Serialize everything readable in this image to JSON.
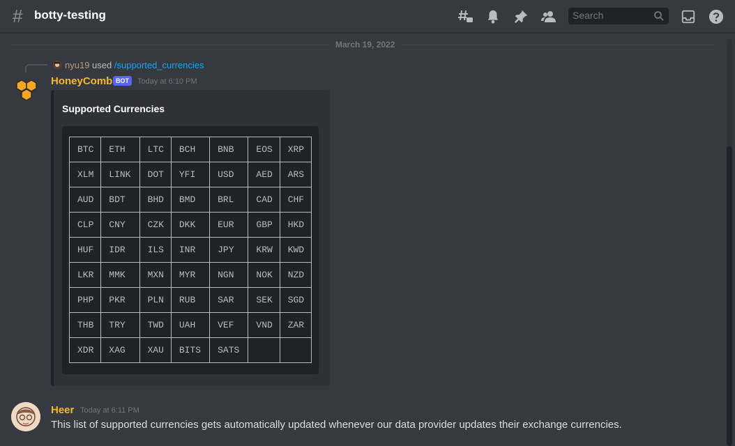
{
  "channel": {
    "hash": "#",
    "name": "botty-testing"
  },
  "toolbar": {
    "icons": [
      "threads-icon",
      "bell-icon",
      "pin-icon",
      "members-icon",
      "inbox-icon",
      "help-icon"
    ],
    "search_placeholder": "Search"
  },
  "divider": {
    "date": "March 19, 2022"
  },
  "reply": {
    "user": "nyu19",
    "used": "used",
    "command": "/supported_currencies"
  },
  "bot_message": {
    "author": "HoneyComb",
    "badge": "BOT",
    "timestamp": "Today at 6:10 PM",
    "author_color": "#f8b82d",
    "embed": {
      "title": "Supported Currencies",
      "rows": [
        [
          "BTC",
          "ETH",
          "LTC",
          "BCH",
          "BNB",
          "EOS",
          "XRP"
        ],
        [
          "XLM",
          "LINK",
          "DOT",
          "YFI",
          "USD",
          "AED",
          "ARS"
        ],
        [
          "AUD",
          "BDT",
          "BHD",
          "BMD",
          "BRL",
          "CAD",
          "CHF"
        ],
        [
          "CLP",
          "CNY",
          "CZK",
          "DKK",
          "EUR",
          "GBP",
          "HKD"
        ],
        [
          "HUF",
          "IDR",
          "ILS",
          "INR",
          "JPY",
          "KRW",
          "KWD"
        ],
        [
          "LKR",
          "MMK",
          "MXN",
          "MYR",
          "NGN",
          "NOK",
          "NZD"
        ],
        [
          "PHP",
          "PKR",
          "PLN",
          "RUB",
          "SAR",
          "SEK",
          "SGD"
        ],
        [
          "THB",
          "TRY",
          "TWD",
          "UAH",
          "VEF",
          "VND",
          "ZAR"
        ],
        [
          "XDR",
          "XAG",
          "XAU",
          "BITS",
          "SATS",
          "",
          ""
        ]
      ]
    }
  },
  "user_message": {
    "author": "Heer",
    "timestamp": "Today at 6:11 PM",
    "text": "This list of supported currencies gets automatically updated whenever our data provider updates their exchange currencies."
  },
  "colors": {
    "background": "#36393f",
    "embed_bg": "#2f3136",
    "code_bg": "#202225",
    "bot_badge": "#5865f2",
    "link": "#00aff4"
  }
}
